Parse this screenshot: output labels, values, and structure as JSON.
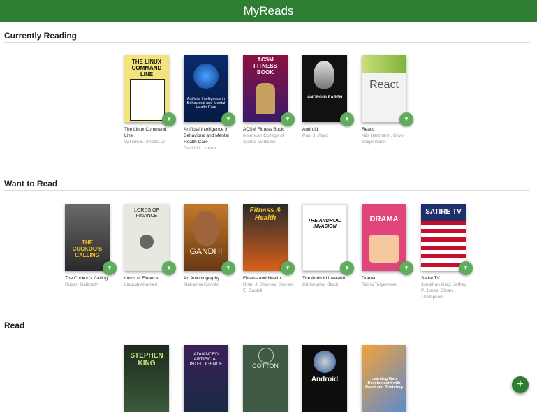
{
  "app": {
    "title": "MyReads"
  },
  "colors": {
    "header": "#2e7d32",
    "shelf_changer": "#60ac5d",
    "add_button": "#2e7d32"
  },
  "shelves": [
    {
      "title": "Currently Reading",
      "books": [
        {
          "title": "The Linux Command Line",
          "authors": "William E. Shotts, Jr.",
          "cover_text": "THE LINUX COMMAND LINE"
        },
        {
          "title": "Artificial Intelligence in Behavioral and Mental Health Care",
          "authors": "David D. Luxton",
          "cover_text": "Artificial Intelligence in Behavioral and Mental Health Care"
        },
        {
          "title": "ACSM Fitness Book",
          "authors": "American College of Sports Medicine",
          "cover_text": "ACSM FITNESS BOOK"
        },
        {
          "title": "Android",
          "authors": "Paul J. Ward",
          "cover_text": "ANDROID EARTH"
        },
        {
          "title": "React",
          "authors": "Nils Hartmann, Oliver Zeigermann",
          "cover_text": "React"
        }
      ]
    },
    {
      "title": "Want to Read",
      "books": [
        {
          "title": "The Cuckoo's Calling",
          "authors": "Robert Galbraith",
          "cover_text": "THE CUCKOO'S CALLING"
        },
        {
          "title": "Lords of Finance",
          "authors": "Liaquat Ahamed",
          "cover_text": "LORDS OF FINANCE"
        },
        {
          "title": "An Autobiography",
          "authors": "Mahatma Gandhi",
          "cover_text": "GANDHI"
        },
        {
          "title": "Fitness and Health",
          "authors": "Brian J. Sharkey, Steven E. Gaskill",
          "cover_text": "Fitness & Health"
        },
        {
          "title": "The Android Invasion",
          "authors": "Christopher Black",
          "cover_text": "THE ANDROID INVASION"
        },
        {
          "title": "Drama",
          "authors": "Raina Telgemeier",
          "cover_text": "DRAMA"
        },
        {
          "title": "Satire TV",
          "authors": "Jonathan Gray, Jeffrey P. Jones, Ethan Thompson",
          "cover_text": "SATIRE TV"
        }
      ]
    },
    {
      "title": "Read",
      "books": [
        {
          "title": "",
          "authors": "",
          "cover_text": "STEPHEN KING"
        },
        {
          "title": "",
          "authors": "",
          "cover_text": "ADVANCED ARTIFICIAL INTELLIGENCE"
        },
        {
          "title": "",
          "authors": "",
          "cover_text": "COTTON"
        },
        {
          "title": "",
          "authors": "",
          "cover_text": "Android"
        },
        {
          "title": "",
          "authors": "",
          "cover_text": "Learning Web Development with React and Bootstrap"
        }
      ]
    }
  ],
  "icons": {
    "shelf_changer": "triangle-down-icon",
    "add": "plus-icon"
  },
  "add_button_label": "+"
}
